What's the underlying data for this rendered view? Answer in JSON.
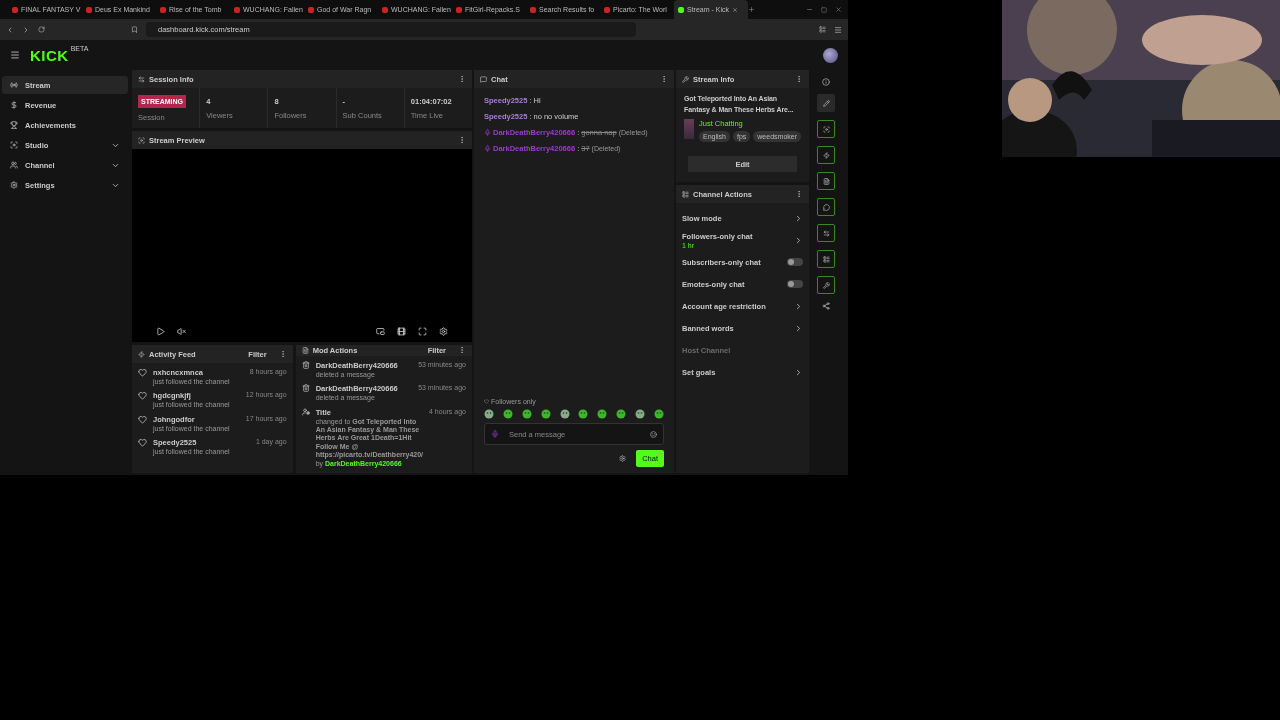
{
  "browser": {
    "tabs": [
      {
        "title": "FINAL FANTASY V",
        "selected": false
      },
      {
        "title": "Deus Ex Mankind",
        "selected": false
      },
      {
        "title": "Rise of the Tomb",
        "selected": false
      },
      {
        "title": "WUCHANG: Fallen",
        "selected": false
      },
      {
        "title": "God of War Ragn",
        "selected": false
      },
      {
        "title": "WUCHANG: Fallen",
        "selected": false
      },
      {
        "title": "FitGirl-Repacks.S",
        "selected": false
      },
      {
        "title": "Search Results fo",
        "selected": false
      },
      {
        "title": "Picarto: The Worl",
        "selected": false
      },
      {
        "title": "Stream - Kick",
        "selected": true
      }
    ],
    "url": "dashboard.kick.com/stream"
  },
  "header": {
    "logo": "KICK",
    "logo_badge": "BETA"
  },
  "sidebar": {
    "items": [
      {
        "label": "Stream",
        "selected": true,
        "expandable": false
      },
      {
        "label": "Revenue",
        "selected": false,
        "expandable": false
      },
      {
        "label": "Achievements",
        "selected": false,
        "expandable": false
      },
      {
        "label": "Studio",
        "selected": false,
        "expandable": true
      },
      {
        "label": "Channel",
        "selected": false,
        "expandable": true
      },
      {
        "label": "Settings",
        "selected": false,
        "expandable": true
      }
    ]
  },
  "session_info": {
    "title": "Session Info",
    "stats": [
      {
        "kind": "badge",
        "value": "STREAMING",
        "label": "Session"
      },
      {
        "kind": "text",
        "value": "4",
        "label": "Viewers"
      },
      {
        "kind": "text",
        "value": "8",
        "label": "Followers"
      },
      {
        "kind": "text",
        "value": "-",
        "label": "Sub Counts"
      },
      {
        "kind": "text",
        "value": "01:04:07:02",
        "label": "Time Live"
      }
    ]
  },
  "stream_preview": {
    "title": "Stream Preview"
  },
  "activity_feed": {
    "title": "Activity Feed",
    "filter": "Filter",
    "items": [
      {
        "user": "nxhcncxmnca",
        "action": "just followed the channel",
        "time": "8 hours ago"
      },
      {
        "user": "hgdcgnkjfj",
        "action": "just followed the channel",
        "time": "12 hours ago"
      },
      {
        "user": "Johngodfor",
        "action": "just followed the channel",
        "time": "17 hours ago"
      },
      {
        "user": "Speedy2525",
        "action": "just followed the channel",
        "time": "1 day ago"
      }
    ]
  },
  "mod_actions": {
    "title": "Mod Actions",
    "filter": "Filter",
    "items": [
      {
        "kind": "delete",
        "user": "DarkDeathBerry420666",
        "action": "deleted a message",
        "time": "53 minutes ago"
      },
      {
        "kind": "delete",
        "user": "DarkDeathBerry420666",
        "action": "deleted a message",
        "time": "53 minutes ago"
      },
      {
        "kind": "title",
        "user": "Title",
        "action": "changed to **Got Teleported Into An Asian Fantasy & Man These Herbs Are Great 1Death=1Hit Follow Me @ https://picarto.tv/Deathberry420/** by",
        "by_user": "DarkDeathBerry420666",
        "time": "4 hours ago"
      }
    ]
  },
  "chat": {
    "title": "Chat",
    "messages": [
      {
        "user": "Speedy2525",
        "text": "Hi",
        "mod": false,
        "deleted": false
      },
      {
        "user": "Speedy2525",
        "text": "no no volume",
        "mod": false,
        "deleted": false
      },
      {
        "user": "DarkDeathBerry420666",
        "text": "gonna nap",
        "mod": true,
        "deleted": true,
        "note": "(Deleted)"
      },
      {
        "user": "DarkDeathBerry420666",
        "text": "37",
        "mod": true,
        "deleted": true,
        "note": "(Deleted)"
      }
    ],
    "separator": ":",
    "mode": "Followers only",
    "placeholder": "Send a message",
    "send": "Chat"
  },
  "stream_info": {
    "title": "Stream Info",
    "stream_title": "Got Teleported Into An Asian Fantasy & Man These Herbs Are...",
    "category": "Just Chatting",
    "tags": [
      "English",
      "fps",
      "weedsmoker"
    ],
    "edit": "Edit"
  },
  "channel_actions": {
    "title": "Channel Actions",
    "items": [
      {
        "kind": "link",
        "label": "Slow mode"
      },
      {
        "kind": "link",
        "label": "Followers-only chat",
        "sub": "1 hr"
      },
      {
        "kind": "toggle",
        "label": "Subscribers-only chat",
        "on": false
      },
      {
        "kind": "toggle",
        "label": "Emotes-only chat",
        "on": false
      },
      {
        "kind": "link",
        "label": "Account age restriction"
      },
      {
        "kind": "link",
        "label": "Banned words"
      },
      {
        "kind": "disabled",
        "label": "Host Channel"
      },
      {
        "kind": "link",
        "label": "Set goals"
      }
    ]
  }
}
